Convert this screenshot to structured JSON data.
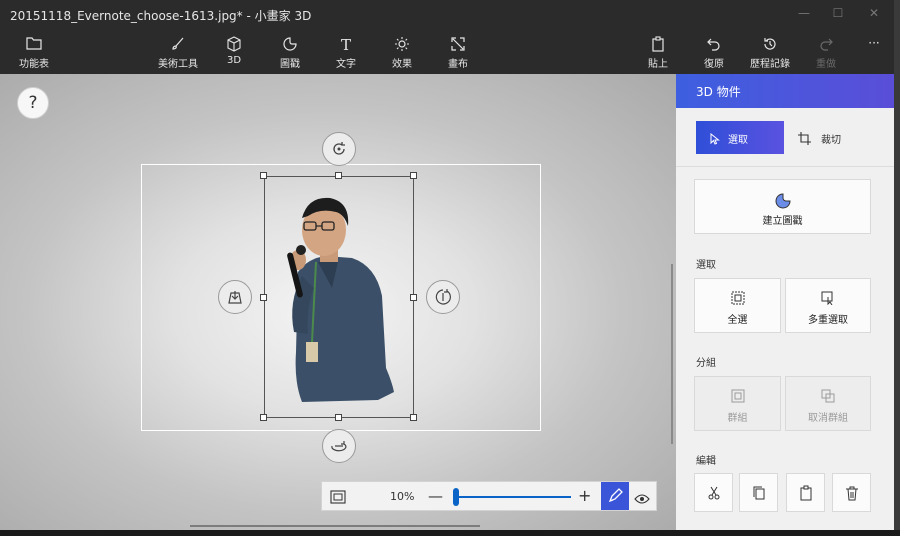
{
  "window": {
    "title": "20151118_Evernote_choose-1613.jpg* - 小畫家 3D"
  },
  "toolbar": {
    "menu": "功能表",
    "brushes": "美術工具",
    "shapes3d": "3D",
    "stickers": "圖戳",
    "text": "文字",
    "effects": "效果",
    "canvas": "畫布",
    "paste": "貼上",
    "undo": "復原",
    "history": "歷程記錄",
    "redo": "重做",
    "more": "···"
  },
  "canvas": {
    "help": "?",
    "zoom": "10%"
  },
  "panel": {
    "title": "3D 物件",
    "select_mode": "選取",
    "crop_mode": "裁切",
    "make_sticker": "建立圖戳",
    "select_section": "選取",
    "select_all": "全選",
    "multi_select": "多重選取",
    "group_section": "分組",
    "group": "群組",
    "ungroup": "取消群組",
    "edit_section": "編輯"
  },
  "colors": {
    "accent": "#3d5fe0",
    "toolbar_bg": "#2b2b2b"
  }
}
